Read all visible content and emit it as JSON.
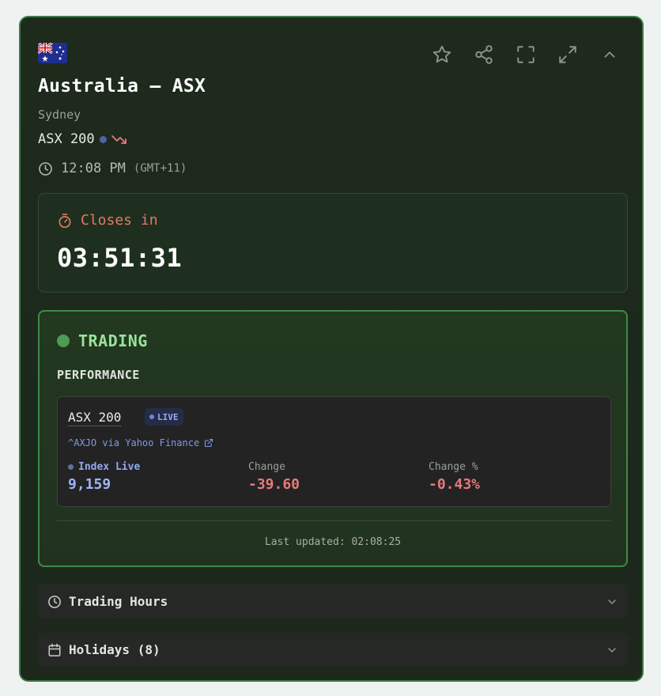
{
  "market": {
    "title": "Australia – ASX",
    "city": "Sydney",
    "index_name": "ASX 200",
    "local_time": "12:08 PM",
    "timezone": "(GMT+11)"
  },
  "countdown": {
    "label": "Closes in",
    "value": "03:51:31"
  },
  "status": {
    "label": "TRADING"
  },
  "performance": {
    "heading": "PERFORMANCE",
    "index_name": "ASX 200",
    "live_badge": "LIVE",
    "source": "^AXJO via Yahoo Finance",
    "metrics": [
      {
        "label": "Index Live",
        "value": "9,159"
      },
      {
        "label": "Change",
        "value": "-39.60"
      },
      {
        "label": "Change %",
        "value": "-0.43%"
      }
    ],
    "last_updated": "Last updated: 02:08:25"
  },
  "sections": [
    {
      "label": "Trading Hours",
      "icon": "clock-icon"
    },
    {
      "label": "Holidays (8)",
      "icon": "calendar-icon"
    }
  ],
  "colors": {
    "accent_green": "#9be29b",
    "negative_red": "#e8797a",
    "live_blue": "#9fb4f2",
    "countdown_orange": "#e07b62"
  }
}
